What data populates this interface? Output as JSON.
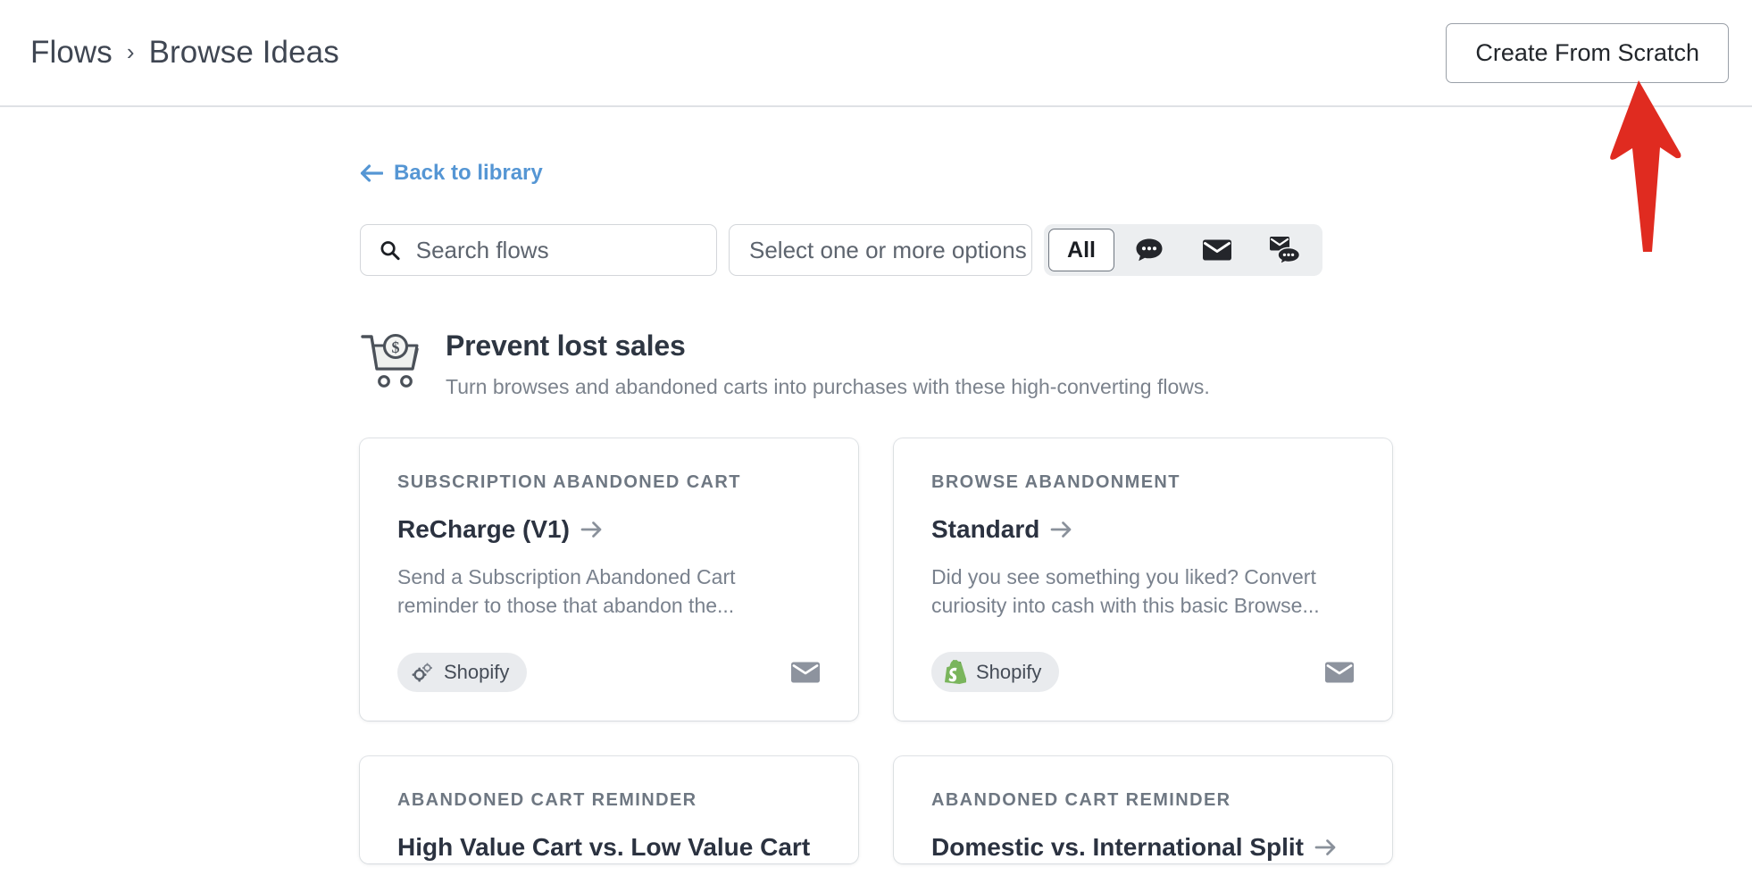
{
  "header": {
    "breadcrumb": [
      "Flows",
      "Browse Ideas"
    ],
    "separator": "›",
    "create_button": "Create From Scratch"
  },
  "annotation": {
    "type": "arrow",
    "color": "#e02b20",
    "points_at": "create-from-scratch-button"
  },
  "body": {
    "back_link": "Back to library",
    "back_link_color": "#5596d4"
  },
  "filters": {
    "search_placeholder": "Search flows",
    "search_value": "",
    "select_label": "Select one or more options",
    "channel_toggle": {
      "selected": "All",
      "options": [
        {
          "label": "All",
          "icon": "text-all",
          "active": true
        },
        {
          "label": "SMS",
          "icon": "chat-bubble-icon",
          "active": false
        },
        {
          "label": "Email",
          "icon": "envelope-icon",
          "active": false
        },
        {
          "label": "Email and SMS",
          "icon": "envelope-chat-icon",
          "active": false
        }
      ]
    }
  },
  "section": {
    "icon": "shopping-cart-dollar-icon",
    "title": "Prevent lost sales",
    "subtitle": "Turn browses and abandoned carts into purchases with these high-converting flows."
  },
  "cards": [
    {
      "eyebrow": "SUBSCRIPTION ABANDONED CART",
      "title": "ReCharge (V1)",
      "arrow": "→",
      "description": "Send a Subscription Abandoned Cart reminder to those that abandon the...",
      "badge": {
        "label": "Shopify",
        "icon": "gears-icon"
      },
      "channel_icon": "envelope-icon"
    },
    {
      "eyebrow": "BROWSE ABANDONMENT",
      "title": "Standard",
      "arrow": "→",
      "description": "Did you see something you liked? Convert curiosity into cash with this basic Browse...",
      "badge": {
        "label": "Shopify",
        "icon": "shopify-logo-icon"
      },
      "channel_icon": "envelope-icon"
    },
    {
      "eyebrow": "ABANDONED CART REMINDER",
      "title": "High Value Cart vs. Low Value Cart",
      "arrow": "→",
      "description": "",
      "badge": {
        "label": "",
        "icon": ""
      },
      "channel_icon": ""
    },
    {
      "eyebrow": "ABANDONED CART REMINDER",
      "title": "Domestic vs. International Split",
      "arrow": "→",
      "description": "",
      "badge": {
        "label": "",
        "icon": ""
      },
      "channel_icon": ""
    }
  ],
  "colors": {
    "accent_link": "#5596d4",
    "annotation_red": "#e02b20",
    "shopify_green": "#7ab55c",
    "text_dark": "#2b3240",
    "text_muted": "#79818d"
  }
}
